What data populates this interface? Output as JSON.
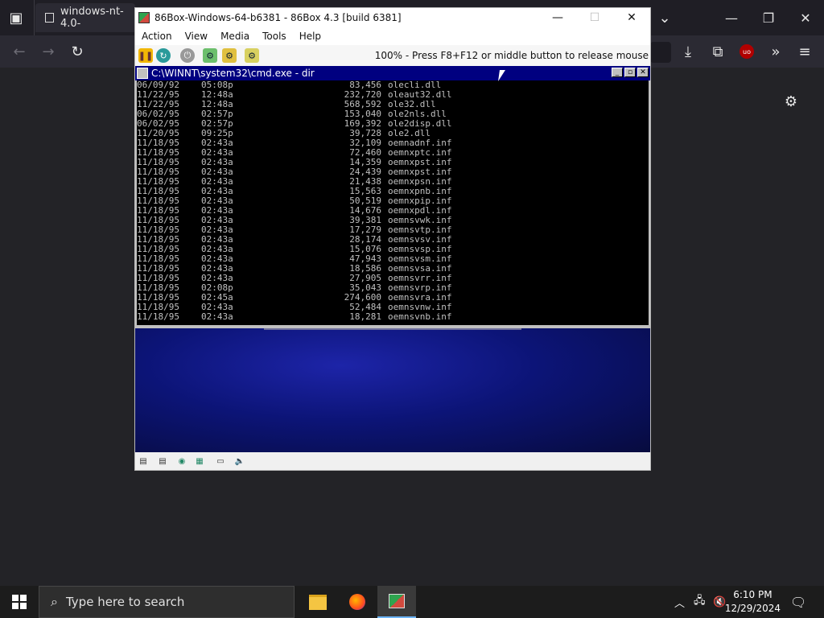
{
  "browser": {
    "tab_title": "windows-nt-4.0-",
    "settings_icon": "gear-icon"
  },
  "vm_window": {
    "title": "86Box-Windows-64-b6381 - 86Box 4.3 [build 6381]",
    "menu": [
      "Action",
      "View",
      "Media",
      "Tools",
      "Help"
    ],
    "status": "100% - Press F8+F12 or middle button to release mouse"
  },
  "cmd": {
    "title": "C:\\WINNT\\system32\\cmd.exe - dir",
    "rows": [
      {
        "date": "06/09/92",
        "time": "05:08p",
        "size": "83,456",
        "name": "olecli.dll"
      },
      {
        "date": "11/22/95",
        "time": "12:48a",
        "size": "232,720",
        "name": "oleaut32.dll"
      },
      {
        "date": "11/22/95",
        "time": "12:48a",
        "size": "568,592",
        "name": "ole32.dll"
      },
      {
        "date": "06/02/95",
        "time": "02:57p",
        "size": "153,040",
        "name": "ole2nls.dll"
      },
      {
        "date": "06/02/95",
        "time": "02:57p",
        "size": "169,392",
        "name": "ole2disp.dll"
      },
      {
        "date": "11/20/95",
        "time": "09:25p",
        "size": "39,728",
        "name": "ole2.dll"
      },
      {
        "date": "11/18/95",
        "time": "02:43a",
        "size": "32,109",
        "name": "oemnadnf.inf"
      },
      {
        "date": "11/18/95",
        "time": "02:43a",
        "size": "72,460",
        "name": "oemnxptc.inf"
      },
      {
        "date": "11/18/95",
        "time": "02:43a",
        "size": "14,359",
        "name": "oemnxpst.inf"
      },
      {
        "date": "11/18/95",
        "time": "02:43a",
        "size": "24,439",
        "name": "oemnxpst.inf"
      },
      {
        "date": "11/18/95",
        "time": "02:43a",
        "size": "21,438",
        "name": "oemnxpsn.inf"
      },
      {
        "date": "11/18/95",
        "time": "02:43a",
        "size": "15,563",
        "name": "oemnxpnb.inf"
      },
      {
        "date": "11/18/95",
        "time": "02:43a",
        "size": "50,519",
        "name": "oemnxpip.inf"
      },
      {
        "date": "11/18/95",
        "time": "02:43a",
        "size": "14,676",
        "name": "oemnxpdl.inf"
      },
      {
        "date": "11/18/95",
        "time": "02:43a",
        "size": "39,381",
        "name": "oemnsvwk.inf"
      },
      {
        "date": "11/18/95",
        "time": "02:43a",
        "size": "17,279",
        "name": "oemnsvtp.inf"
      },
      {
        "date": "11/18/95",
        "time": "02:43a",
        "size": "28,174",
        "name": "oemnsvsv.inf"
      },
      {
        "date": "11/18/95",
        "time": "02:43a",
        "size": "15,076",
        "name": "oemnsvsp.inf"
      },
      {
        "date": "11/18/95",
        "time": "02:43a",
        "size": "47,943",
        "name": "oemnsvsm.inf"
      },
      {
        "date": "11/18/95",
        "time": "02:43a",
        "size": "18,586",
        "name": "oemnsvsa.inf"
      },
      {
        "date": "11/18/95",
        "time": "02:43a",
        "size": "27,905",
        "name": "oemnsvrr.inf"
      },
      {
        "date": "11/18/95",
        "time": "02:08p",
        "size": "35,043",
        "name": "oemnsvrp.inf"
      },
      {
        "date": "11/18/95",
        "time": "02:45a",
        "size": "274,600",
        "name": "oemnsvra.inf"
      },
      {
        "date": "11/18/95",
        "time": "02:43a",
        "size": "52,484",
        "name": "oemnsvnw.inf"
      },
      {
        "date": "11/18/95",
        "time": "02:43a",
        "size": "18,281",
        "name": "oemnsvnb.inf"
      }
    ]
  },
  "taskbar": {
    "search_placeholder": "Type here to search",
    "time": "6:10 PM",
    "date": "12/29/2024"
  }
}
